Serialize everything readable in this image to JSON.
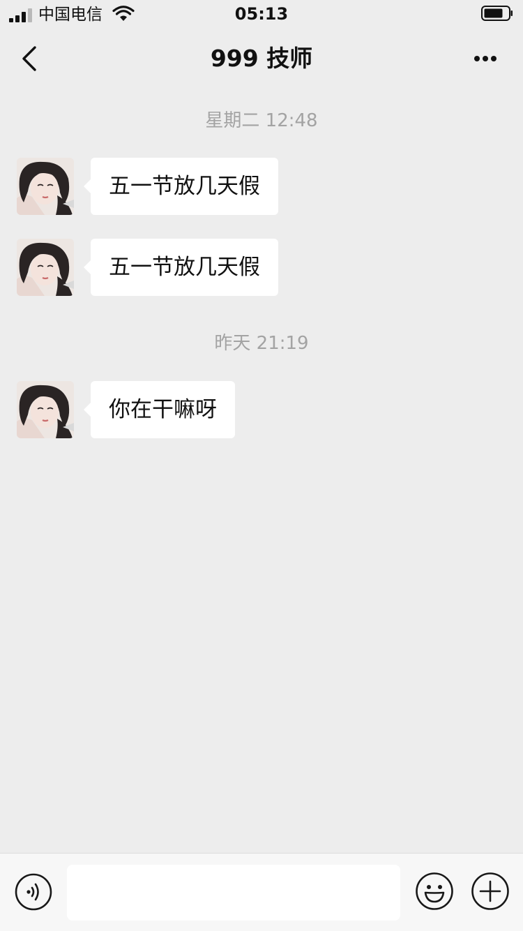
{
  "status_bar": {
    "carrier": "中国电信",
    "time": "05:13",
    "icons": [
      "signal-icon",
      "wifi-icon",
      "battery-icon"
    ]
  },
  "nav": {
    "title": "999 技师",
    "back_icon": "chevron-left-icon",
    "more_icon": "more-dots-icon"
  },
  "chat": {
    "groups": [
      {
        "timestamp": "星期二 12:48",
        "messages": [
          {
            "sender": "contact",
            "text": "五一节放几天假"
          },
          {
            "sender": "contact",
            "text": "五一节放几天假"
          }
        ]
      },
      {
        "timestamp": "昨天 21:19",
        "messages": [
          {
            "sender": "contact",
            "text": "你在干嘛呀"
          }
        ]
      }
    ]
  },
  "input_bar": {
    "value": "",
    "placeholder": "",
    "left_icon": "voice-icon",
    "right_icons": [
      "emoji-icon",
      "plus-icon"
    ]
  },
  "colors": {
    "background": "#ededed",
    "bubble": "#ffffff",
    "timestamp": "#a3a3a3",
    "input_bar": "#f7f7f7"
  }
}
